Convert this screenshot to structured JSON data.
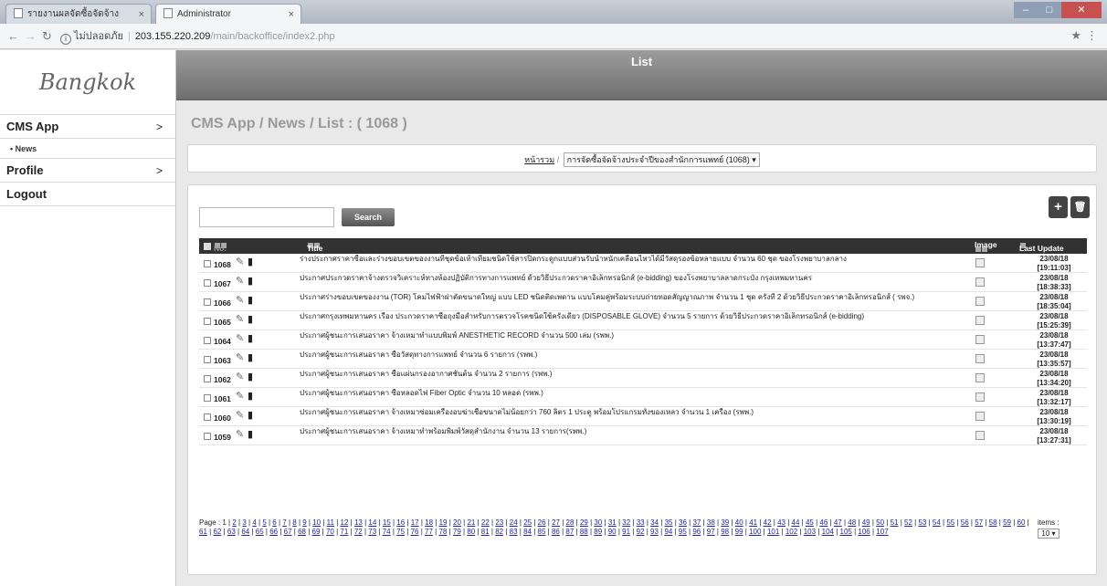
{
  "browser": {
    "tabs": [
      {
        "title": "รายงานผลจัดซื้อจัดจ้าง",
        "active": false
      },
      {
        "title": "Administrator",
        "active": true
      }
    ],
    "address": {
      "security_label": "ไม่ปลอดภัย",
      "host": "203.155.220.209",
      "path": "/main/backoffice/index2.php"
    }
  },
  "sidebar": {
    "brand": "Bangkok",
    "items": [
      {
        "label": "CMS App",
        "chevron": ">",
        "sub": "• News"
      },
      {
        "label": "Profile",
        "chevron": ">"
      },
      {
        "label": "Logout"
      }
    ]
  },
  "header": {
    "title": "List"
  },
  "breadcrumb": "CMS App / News / List : ( 1068 )",
  "filter": {
    "label": "หน้ารวม",
    "selected": "การจัดซื้อจัดจ้างประจำปีของสำนักการแพทย์ (1068)"
  },
  "search": {
    "placeholder": "",
    "button_label": "Search"
  },
  "toolbar": {
    "add_icon": "+",
    "delete_icon": "trash-icon"
  },
  "table": {
    "columns": {
      "no": "No.",
      "title": "Title",
      "image": "Image",
      "last_update": "Last Update"
    },
    "rows": [
      {
        "no": "1068",
        "title": "ร่างประกาศราคาซื้อและร่างขอบเขตของงานที่ชุดข้อเท้าเทียมชนิดใช้สารปิดกระดูกแบบส่วนรับน้ำหนักเคลื่อนไหวได้มีวัสดุรองข้อหลายแบบ จำนวน 60 ชุด ของโรงพยาบาลกลาง",
        "date": "23/08/18",
        "time": "[19:11:03]"
      },
      {
        "no": "1067",
        "title": "ประกาศประกวดราคาจ้างตรวจวิเคราะห์ทางห้องปฏิบัติการทางการแพทย์ ด้วยวิธีประกวดราคาอิเล็กทรอนิกส์ (e-bidding) ของโรงพยาบาลลาดกระบัง กรุงเทพมหานคร",
        "date": "23/08/18",
        "time": "[18:38:33]"
      },
      {
        "no": "1066",
        "title": "ประกาศร่างขอบเขตของงาน (TOR) โคมไฟฟ้าผ่าตัดขนาดใหญ่ แบบ LED ชนิดติดเพดาน แบบโคมคู่พร้อมระบบถ่ายทอดสัญญาณภาพ จำนวน 1 ชุด ครั้งที่ 2 ด้วยวิธีประกวดราคาอิเล็กทรอนิกส์ ( รพจ.)",
        "date": "23/08/18",
        "time": "[18:35:04]"
      },
      {
        "no": "1065",
        "title": "ประกาศกรุงเทพมหานคร เรื่อง ประกวดราคาซื้อถุงมือสำหรับการตรวจโรคชนิดใช้ครั้งเดียว (DISPOSABLE GLOVE) จำนวน 5 รายการ ด้วยวิธีประกวดราคาอิเล็กทรอนิกส์ (e-bidding)",
        "date": "23/08/18",
        "time": "[15:25:39]"
      },
      {
        "no": "1064",
        "title": "ประกาศผู้ชนะการเสนอราคา จ้างเหมาทำแบบพิมพ์ ANESTHETIC RECORD จำนวน 500 เล่ม (รพพ.)",
        "date": "23/08/18",
        "time": "[13:37:47]"
      },
      {
        "no": "1063",
        "title": "ประกาศผู้ชนะการเสนอราคา ซื้อวัสดุทางการแพทย์ จำนวน 6 รายการ (รพพ.)",
        "date": "23/08/18",
        "time": "[13:35:57]"
      },
      {
        "no": "1062",
        "title": "ประกาศผู้ชนะการเสนอราคา ซื้อแผ่นกรองอากาศชั้นต้น จำนวน 2 รายการ (รพพ.)",
        "date": "23/08/18",
        "time": "[13:34:20]"
      },
      {
        "no": "1061",
        "title": "ประกาศผู้ชนะการเสนอราคา ซื้อหลอดไฟ Fiber Optic จำนวน 10 หลอด (รพพ.)",
        "date": "23/08/18",
        "time": "[13:32:17]"
      },
      {
        "no": "1060",
        "title": "ประกาศผู้ชนะการเสนอราคา จ้างเหมาซ่อมเครื่องอบฆ่าเชื้อขนาดไม่น้อยกว่า 760 ลิตร 1 ประตู พร้อมโปรแกรมทั้งของเหลว จำนวน 1 เครื่อง (รพพ.)",
        "date": "23/08/18",
        "time": "[13:30:19]"
      },
      {
        "no": "1059",
        "title": "ประกาศผู้ชนะการเสนอราคา จ้างเหมาทำพร้อมพิมพ์วัสดุสำนักงาน จำนวน 13 รายการ(รพพ.)",
        "date": "23/08/18",
        "time": "[13:27:31]"
      }
    ]
  },
  "pager": {
    "label": "Page :",
    "current": "1",
    "total_pages": 107,
    "items_label": "items :",
    "items_per_page": "10"
  }
}
